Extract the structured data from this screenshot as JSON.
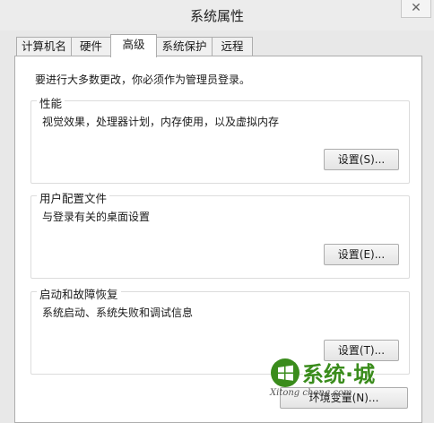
{
  "window": {
    "title": "系统属性",
    "close_symbol": "✕"
  },
  "tabs": [
    {
      "label": "计算机名",
      "active": false
    },
    {
      "label": "硬件",
      "active": false
    },
    {
      "label": "高级",
      "active": true
    },
    {
      "label": "系统保护",
      "active": false
    },
    {
      "label": "远程",
      "active": false
    }
  ],
  "notice": "要进行大多数更改，你必须作为管理员登录。",
  "groups": [
    {
      "title": "性能",
      "description": "视觉效果，处理器计划，内存使用，以及虚拟内存",
      "button": "设置(S)..."
    },
    {
      "title": "用户配置文件",
      "description": "与登录有关的桌面设置",
      "button": "设置(E)..."
    },
    {
      "title": "启动和故障恢复",
      "description": "系统启动、系统失败和调试信息",
      "button": "设置(T)..."
    }
  ],
  "env_button": "环境变量(N)...",
  "watermark": {
    "text": "系统·城",
    "sub": "Xitong cheng.com",
    "icon": "windows-logo-icon",
    "accent": "#3a8c1c"
  }
}
